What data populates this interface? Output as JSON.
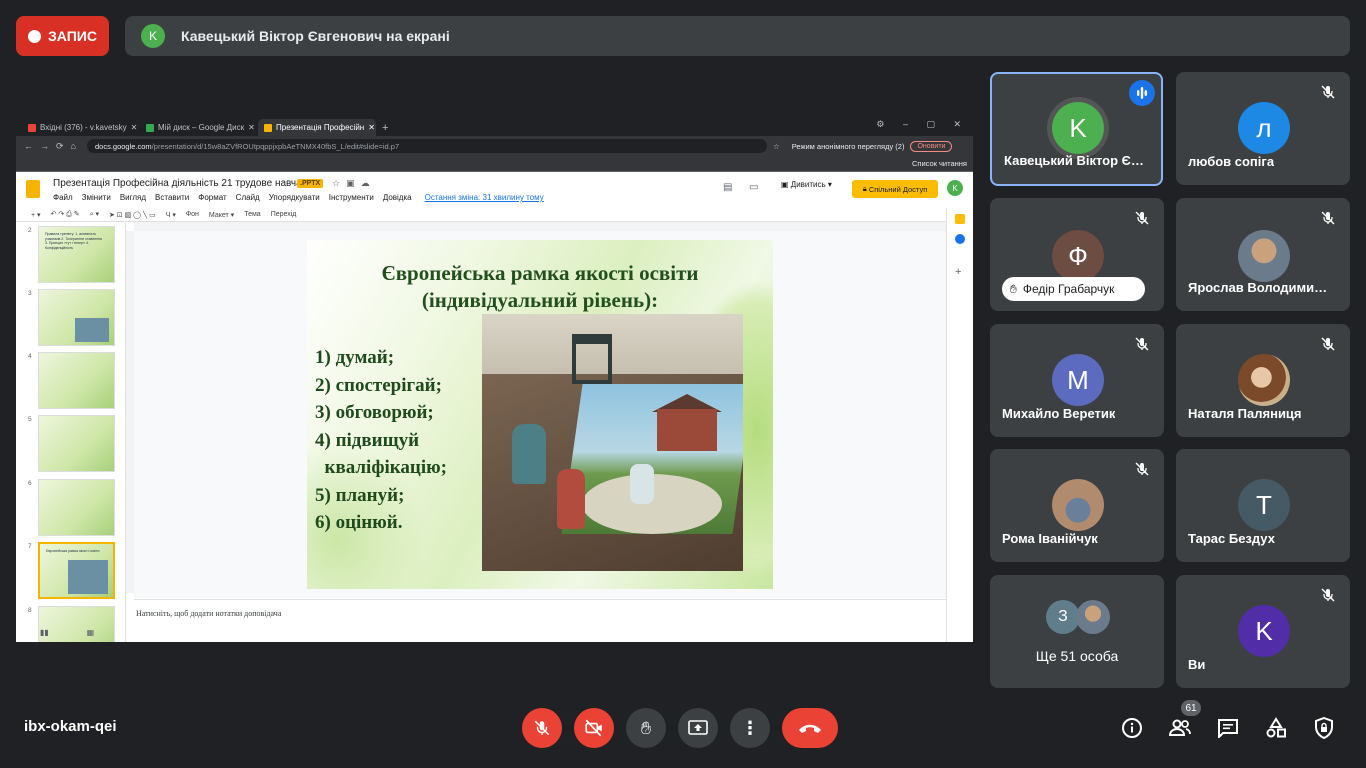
{
  "recording": {
    "label": "ЗАПИС"
  },
  "presenting": {
    "avatar_letter": "K",
    "text": "Кавецький Віктор Євгенович на екрані"
  },
  "browser": {
    "tabs": [
      {
        "label": "Вхідні (376) - v.kavetsky"
      },
      {
        "label": "Мій диск – Google Диск"
      },
      {
        "label": "Презентація Професійн"
      }
    ],
    "new_tab": "+",
    "url_host": "docs.google.com",
    "url_path": "/presentation/d/15w8aZVfROUtpqppjxpbAeTNMX40fbS_L/edit#slide=id.p7",
    "incognito": "Режим анонімного перегляду (2)",
    "update": "Оновити",
    "reading_list": "Список читання"
  },
  "slides_app": {
    "title": "Презентація Професійна діяльність 21 трудове навчання",
    "badge": ".PPTX",
    "menu": [
      "Файл",
      "Змінити",
      "Вигляд",
      "Вставити",
      "Формат",
      "Слайд",
      "Упорядкувати",
      "Інструменти",
      "Довідка"
    ],
    "last_edit": "Остання зміна: 31 хвилину тому",
    "present": "Дивитись",
    "share": "Спільний Доступ",
    "account_letter": "K",
    "toolbar": [
      "Фон",
      "Макет ▾",
      "Тема",
      "Перехід"
    ],
    "notes_placeholder": "Натисніть, щоб додати нотатки доповідача"
  },
  "filmstrip": {
    "slides": [
      {
        "num": "2",
        "text": "Правила тренінгу: 1. активність учасників 2. Толерантне ставлення 3. Принцип «тут і тепер» 4. Конфіденційність"
      },
      {
        "num": "3",
        "text": ""
      },
      {
        "num": "4",
        "text": ""
      },
      {
        "num": "5",
        "text": ""
      },
      {
        "num": "6",
        "text": ""
      },
      {
        "num": "7",
        "text": "Європейська рамка якості освіти"
      },
      {
        "num": "8",
        "text": ""
      }
    ]
  },
  "slide": {
    "title_line1": "Європейська рамка якості освіти",
    "title_line2": "(індивідуальний рівень):",
    "items": [
      "1)   думай;",
      "2)   спостерігай;",
      "3)   обговорюй;",
      "4)   підвищуй",
      "  кваліфікацію;",
      "5)   плануй;",
      "6)   оцінюй."
    ]
  },
  "participants": [
    {
      "name": "Кавецький Віктор Є…",
      "letter": "K",
      "color": "#4caf50",
      "speaking": true
    },
    {
      "name": "любов сопіга",
      "letter": "л",
      "color": "#1e88e5"
    },
    {
      "name": "Федір Грабарчук",
      "letter": "Ф",
      "color": "#6d4c41",
      "hand": true
    },
    {
      "name": "Ярослав Володими…",
      "letter": "",
      "photo": true
    },
    {
      "name": "Михайло Веретик",
      "letter": "M",
      "color": "#5c6bc0"
    },
    {
      "name": "Наталя Паляниця",
      "letter": "",
      "photo": true
    },
    {
      "name": "Рома Іванійчук",
      "letter": "",
      "photo": true
    },
    {
      "name": "Тарас Бездух",
      "letter": "T",
      "color": "#455a64"
    },
    {
      "name": "Ще 51 особа",
      "letter": "З",
      "color": "#607d8b",
      "more": true
    },
    {
      "name": "Ви",
      "letter": "K",
      "color": "#512da8"
    }
  ],
  "bottom": {
    "meeting_code": "ibx-okam-qei",
    "people_count": "61"
  },
  "colors": {
    "record_red": "#d93025",
    "tile_bg": "#3c4043",
    "bg": "#202124",
    "hangup": "#ea4335"
  }
}
